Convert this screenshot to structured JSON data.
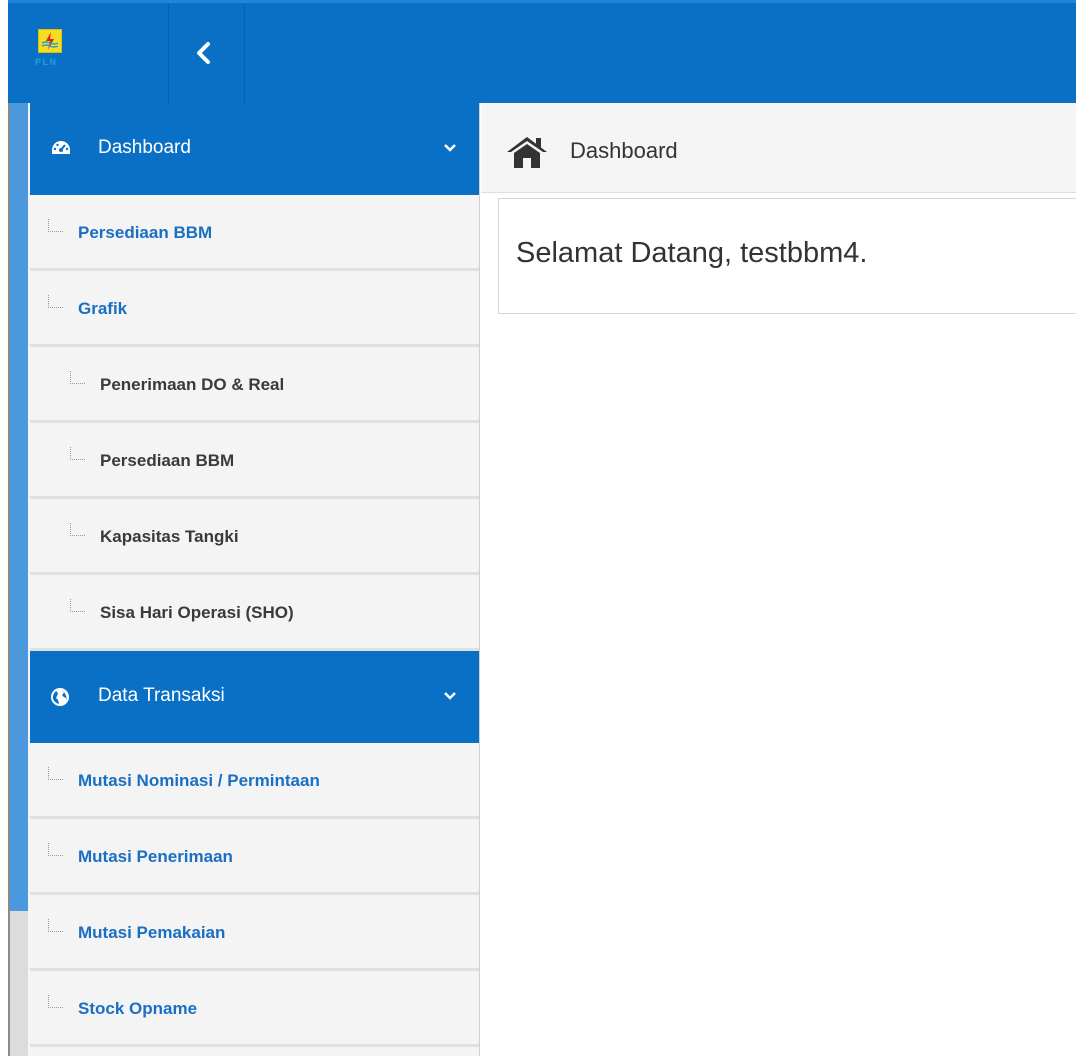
{
  "header": {
    "logo_text": "PLN",
    "brand_color": "#0a70c6",
    "logo_icon": "pln-logo-icon",
    "toggle_icon": "chevron-left-icon"
  },
  "sidebar": {
    "sections": [
      {
        "label": "Dashboard",
        "icon": "dashboard-gauge-icon",
        "items": [
          {
            "label": "Persediaan BBM",
            "level": 1
          },
          {
            "label": "Grafik",
            "level": 1
          },
          {
            "label": "Penerimaan DO & Real",
            "level": 2
          },
          {
            "label": "Persediaan BBM",
            "level": 2
          },
          {
            "label": "Kapasitas Tangki",
            "level": 2
          },
          {
            "label": "Sisa Hari Operasi (SHO)",
            "level": 2
          }
        ]
      },
      {
        "label": "Data Transaksi",
        "icon": "globe-icon",
        "items": [
          {
            "label": "Mutasi Nominasi / Permintaan",
            "level": 1
          },
          {
            "label": "Mutasi Penerimaan",
            "level": 1
          },
          {
            "label": "Mutasi Pemakaian",
            "level": 1
          },
          {
            "label": "Stock Opname",
            "level": 1
          }
        ]
      }
    ]
  },
  "main": {
    "breadcrumb": {
      "label": "Dashboard",
      "icon": "home-icon"
    },
    "welcome": "Selamat Datang, testbbm4."
  }
}
